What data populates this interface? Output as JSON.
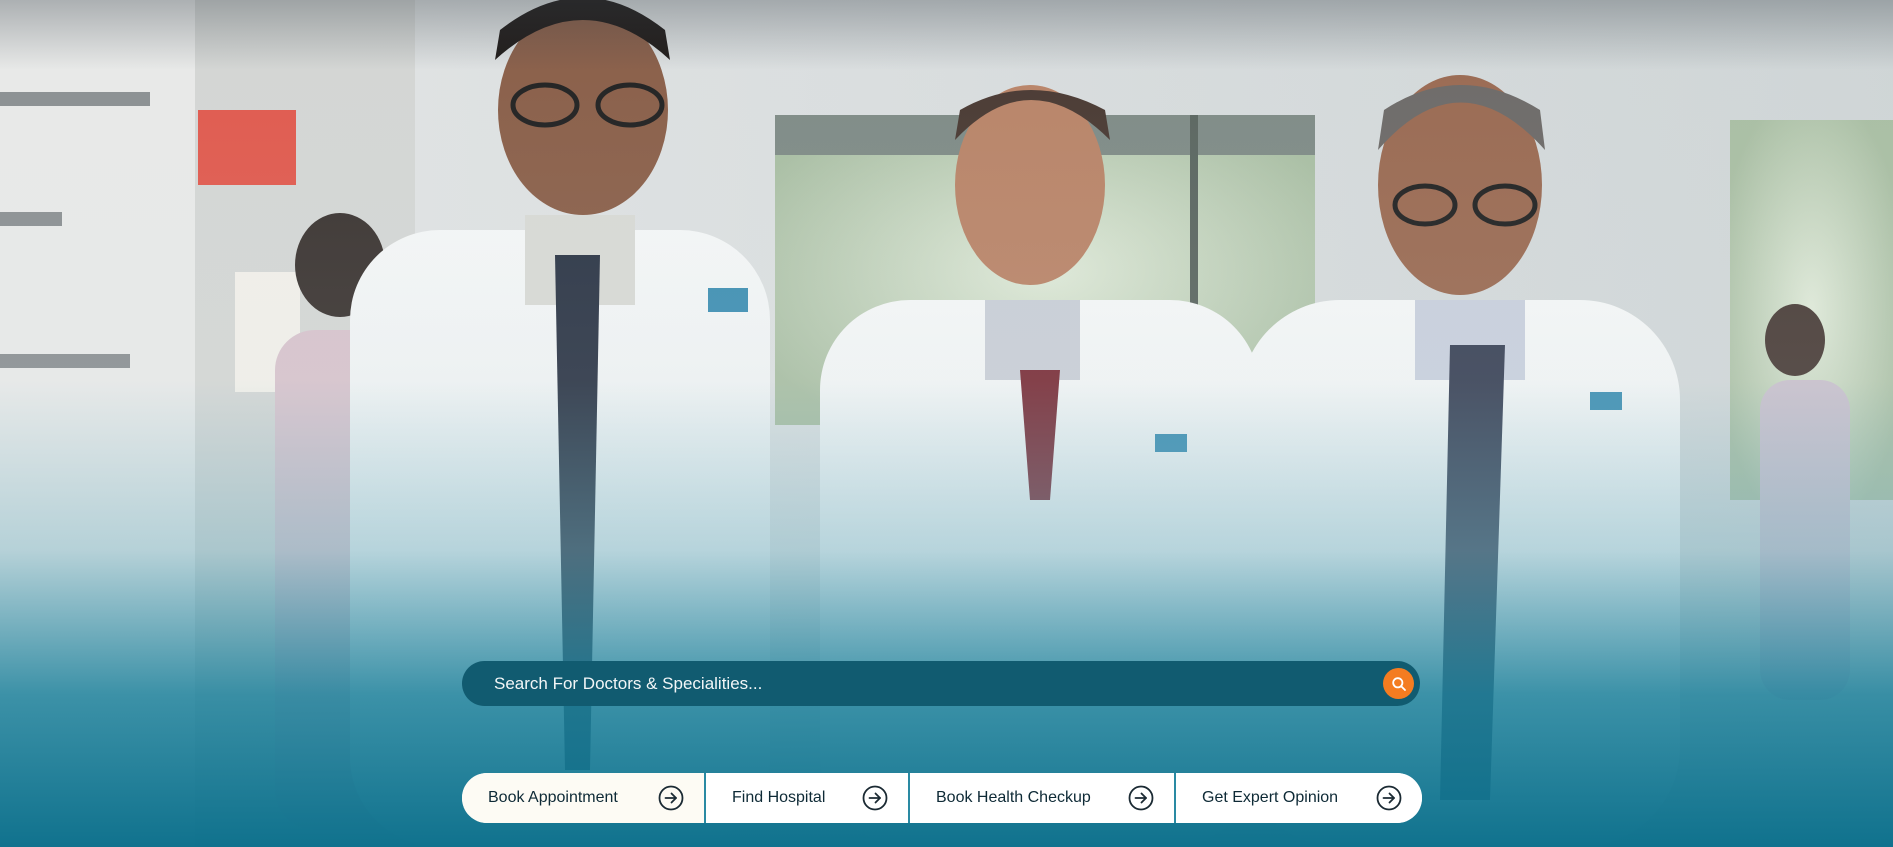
{
  "search": {
    "placeholder": "Search For Doctors & Specialities...",
    "button_icon": "search-icon",
    "accent_color": "#f47c20"
  },
  "quick_actions": [
    {
      "label": "Book Appointment",
      "icon": "arrow-right-circle-icon"
    },
    {
      "label": "Find Hospital",
      "icon": "arrow-right-circle-icon"
    },
    {
      "label": "Book Health Checkup",
      "icon": "arrow-right-circle-icon"
    },
    {
      "label": "Get Expert Opinion",
      "icon": "arrow-right-circle-icon"
    }
  ],
  "colors": {
    "brand_teal": "#0c708c",
    "search_bar": "#115b70"
  }
}
